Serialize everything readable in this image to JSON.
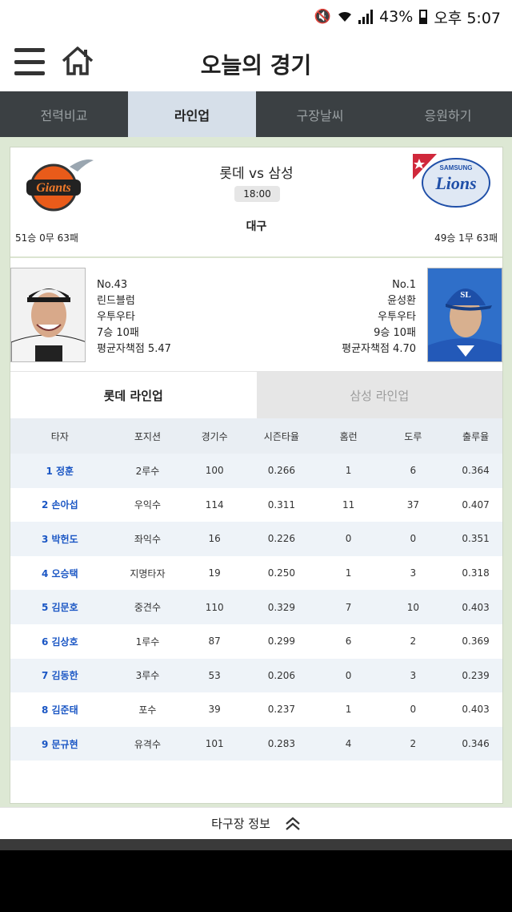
{
  "status_bar": {
    "battery": "43%",
    "time": "오후 5:07"
  },
  "header": {
    "title": "오늘의 경기"
  },
  "tabs": [
    {
      "label": "전력비교",
      "active": false
    },
    {
      "label": "라인업",
      "active": true
    },
    {
      "label": "구장날씨",
      "active": false
    },
    {
      "label": "응원하기",
      "active": false
    }
  ],
  "match": {
    "teams": "롯데 vs 삼성",
    "time": "18:00",
    "stadium": "대구",
    "home_record": "51승 0무 63패",
    "away_record": "49승 1무 63패"
  },
  "pitchers": {
    "left": {
      "no": "No.43",
      "name": "린드블럼",
      "type": "우투우타",
      "record": "7승 10패",
      "era": "평균자책점 5.47"
    },
    "right": {
      "no": "No.1",
      "name": "윤성환",
      "type": "우투우타",
      "record": "9승 10패",
      "era": "평균자책점 4.70"
    }
  },
  "lineup_tabs": {
    "left": "롯데 라인업",
    "right": "삼성 라인업"
  },
  "table": {
    "headers": [
      "타자",
      "포지션",
      "경기수",
      "시즌타율",
      "홈런",
      "도루",
      "출루율"
    ],
    "rows": [
      [
        "1 정훈",
        "2루수",
        "100",
        "0.266",
        "1",
        "6",
        "0.364"
      ],
      [
        "2 손아섭",
        "우익수",
        "114",
        "0.311",
        "11",
        "37",
        "0.407"
      ],
      [
        "3 박헌도",
        "좌익수",
        "16",
        "0.226",
        "0",
        "0",
        "0.351"
      ],
      [
        "4 오승택",
        "지명타자",
        "19",
        "0.250",
        "1",
        "3",
        "0.318"
      ],
      [
        "5 김문호",
        "중견수",
        "110",
        "0.329",
        "7",
        "10",
        "0.403"
      ],
      [
        "6 김상호",
        "1루수",
        "87",
        "0.299",
        "6",
        "2",
        "0.369"
      ],
      [
        "7 김동한",
        "3루수",
        "53",
        "0.206",
        "0",
        "3",
        "0.239"
      ],
      [
        "8 김준태",
        "포수",
        "39",
        "0.237",
        "1",
        "0",
        "0.403"
      ],
      [
        "9 문규현",
        "유격수",
        "101",
        "0.283",
        "4",
        "2",
        "0.346"
      ]
    ]
  },
  "footer": {
    "label": "타구장 정보"
  },
  "logos": {
    "left_text": "Giants",
    "right_text": "Lions",
    "right_sub": "SAMSUNG"
  }
}
